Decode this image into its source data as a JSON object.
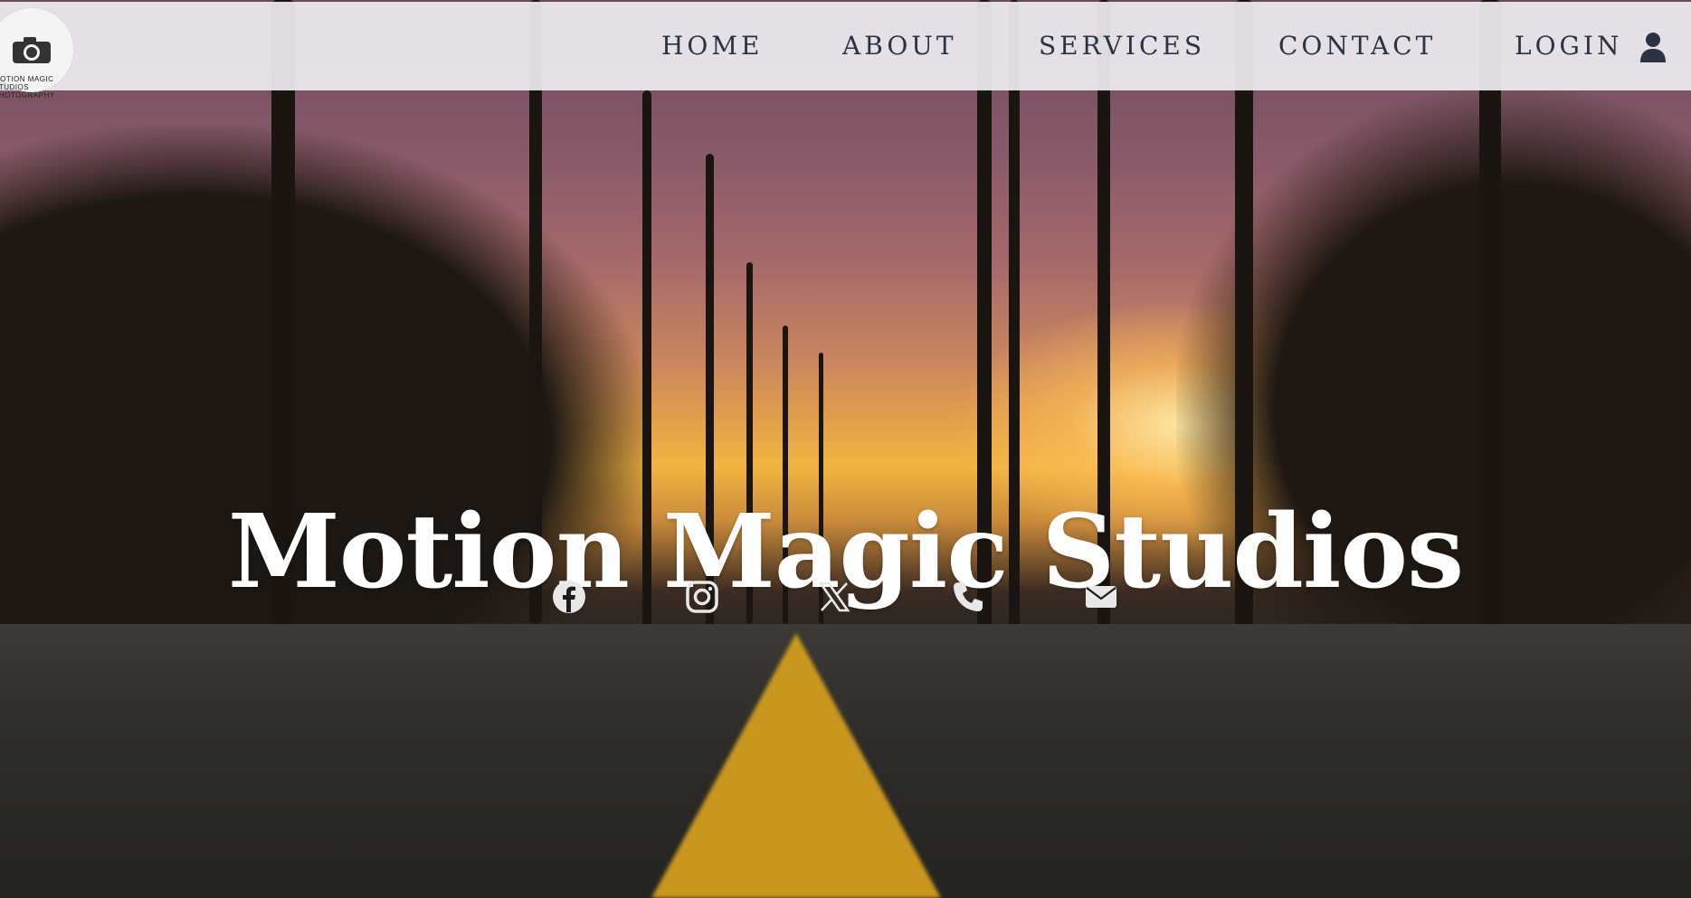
{
  "nav": {
    "logo_text": "MOTION MAGIC STUDIOS PHOTOGRAPHY",
    "links": [
      "HOME",
      "ABOUT",
      "SERVICES",
      "CONTACT",
      "LOGIN"
    ]
  },
  "hero": {
    "title": "Motion Magic Studios"
  },
  "icons": {
    "user": "user-icon",
    "social": [
      "facebook-icon",
      "instagram-icon",
      "x-icon",
      "phone-icon",
      "email-icon"
    ]
  },
  "colors": {
    "nav_text": "#2a3244",
    "title": "#ffffff",
    "social_icon": "#e8e8e8"
  }
}
